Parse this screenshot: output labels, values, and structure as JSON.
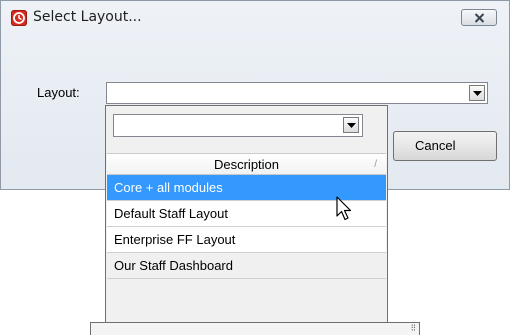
{
  "window": {
    "title": "Select Layout...",
    "app_icon": "clock-icon",
    "close_icon": "close-icon"
  },
  "form": {
    "layout_label": "Layout:",
    "layout_value": ""
  },
  "buttons": {
    "cancel_label": "Cancel"
  },
  "dropdown": {
    "filter_value": "",
    "column_header": "Description",
    "items": [
      {
        "label": "Core + all modules",
        "selected": true
      },
      {
        "label": "Default Staff Layout",
        "selected": false
      },
      {
        "label": "Enterprise FF Layout",
        "selected": false
      },
      {
        "label": "Our Staff Dashboard",
        "selected": false
      }
    ]
  },
  "colors": {
    "selection": "#3399ff",
    "app_icon": "#d62b20"
  }
}
